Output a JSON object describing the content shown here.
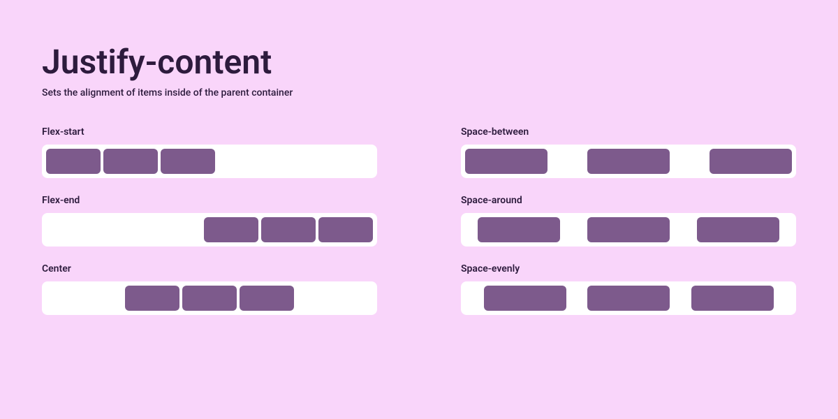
{
  "title": "Justify-content",
  "subtitle": "Sets the alignment of items inside of the parent container",
  "examples": [
    {
      "label": "Flex-start",
      "justify": "flex-start",
      "wide": false
    },
    {
      "label": "Space-between",
      "justify": "space-between",
      "wide": true
    },
    {
      "label": "Flex-end",
      "justify": "flex-end",
      "wide": false
    },
    {
      "label": "Space-around",
      "justify": "space-around",
      "wide": true
    },
    {
      "label": "Center",
      "justify": "center",
      "wide": false
    },
    {
      "label": "Space-evenly",
      "justify": "space-evenly",
      "wide": true
    }
  ],
  "colors": {
    "background": "#f9d5fa",
    "containerBg": "#ffffff",
    "itemBg": "#7d5a8c",
    "text": "#2d1b3d"
  }
}
